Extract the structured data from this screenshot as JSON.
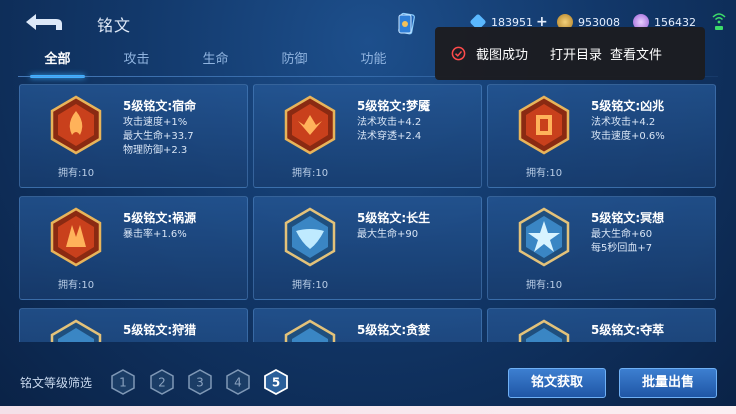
{
  "header": {
    "title": "铭文",
    "resources": [
      {
        "name": "diamond",
        "value": "183951",
        "color": "#5ab8ff"
      },
      {
        "name": "gold",
        "value": "953008",
        "color": "#d6a84a"
      },
      {
        "name": "crystal",
        "value": "156432",
        "color": "#c99af0"
      }
    ],
    "plus": "+"
  },
  "tabs": [
    "全部",
    "攻击",
    "生命",
    "防御",
    "功能"
  ],
  "toast": {
    "message": "截图成功",
    "open_dir": "打开目录",
    "view_file": "查看文件"
  },
  "cards": [
    {
      "name": "5级铭文:宿命",
      "stats": [
        "攻击速度+1%",
        "最大生命+33.7",
        "物理防御+2.3"
      ],
      "owned": "拥有:10",
      "color": "red"
    },
    {
      "name": "5级铭文:梦魇",
      "stats": [
        "法术攻击+4.2",
        "法术穿透+2.4"
      ],
      "owned": "拥有:10",
      "color": "red"
    },
    {
      "name": "5级铭文:凶兆",
      "stats": [
        "法术攻击+4.2",
        "攻击速度+0.6%"
      ],
      "owned": "拥有:10",
      "color": "red"
    },
    {
      "name": "5级铭文:祸源",
      "stats": [
        "暴击率+1.6%"
      ],
      "owned": "拥有:10",
      "color": "red"
    },
    {
      "name": "5级铭文:长生",
      "stats": [
        "最大生命+90"
      ],
      "owned": "拥有:10",
      "color": "blue"
    },
    {
      "name": "5级铭文:冥想",
      "stats": [
        "最大生命+60",
        "每5秒回血+7"
      ],
      "owned": "拥有:10",
      "color": "blue"
    },
    {
      "name": "5级铭文:狩猎",
      "stats": [],
      "owned": "",
      "color": "blue"
    },
    {
      "name": "5级铭文:贪婪",
      "stats": [],
      "owned": "",
      "color": "blue"
    },
    {
      "name": "5级铭文:夺萃",
      "stats": [],
      "owned": "",
      "color": "blue"
    }
  ],
  "footer": {
    "filter_label": "铭文等级筛选",
    "levels": [
      "1",
      "2",
      "3",
      "4",
      "5"
    ],
    "active_level": "5",
    "obtain_button": "铭文获取",
    "sell_button": "批量出售"
  }
}
